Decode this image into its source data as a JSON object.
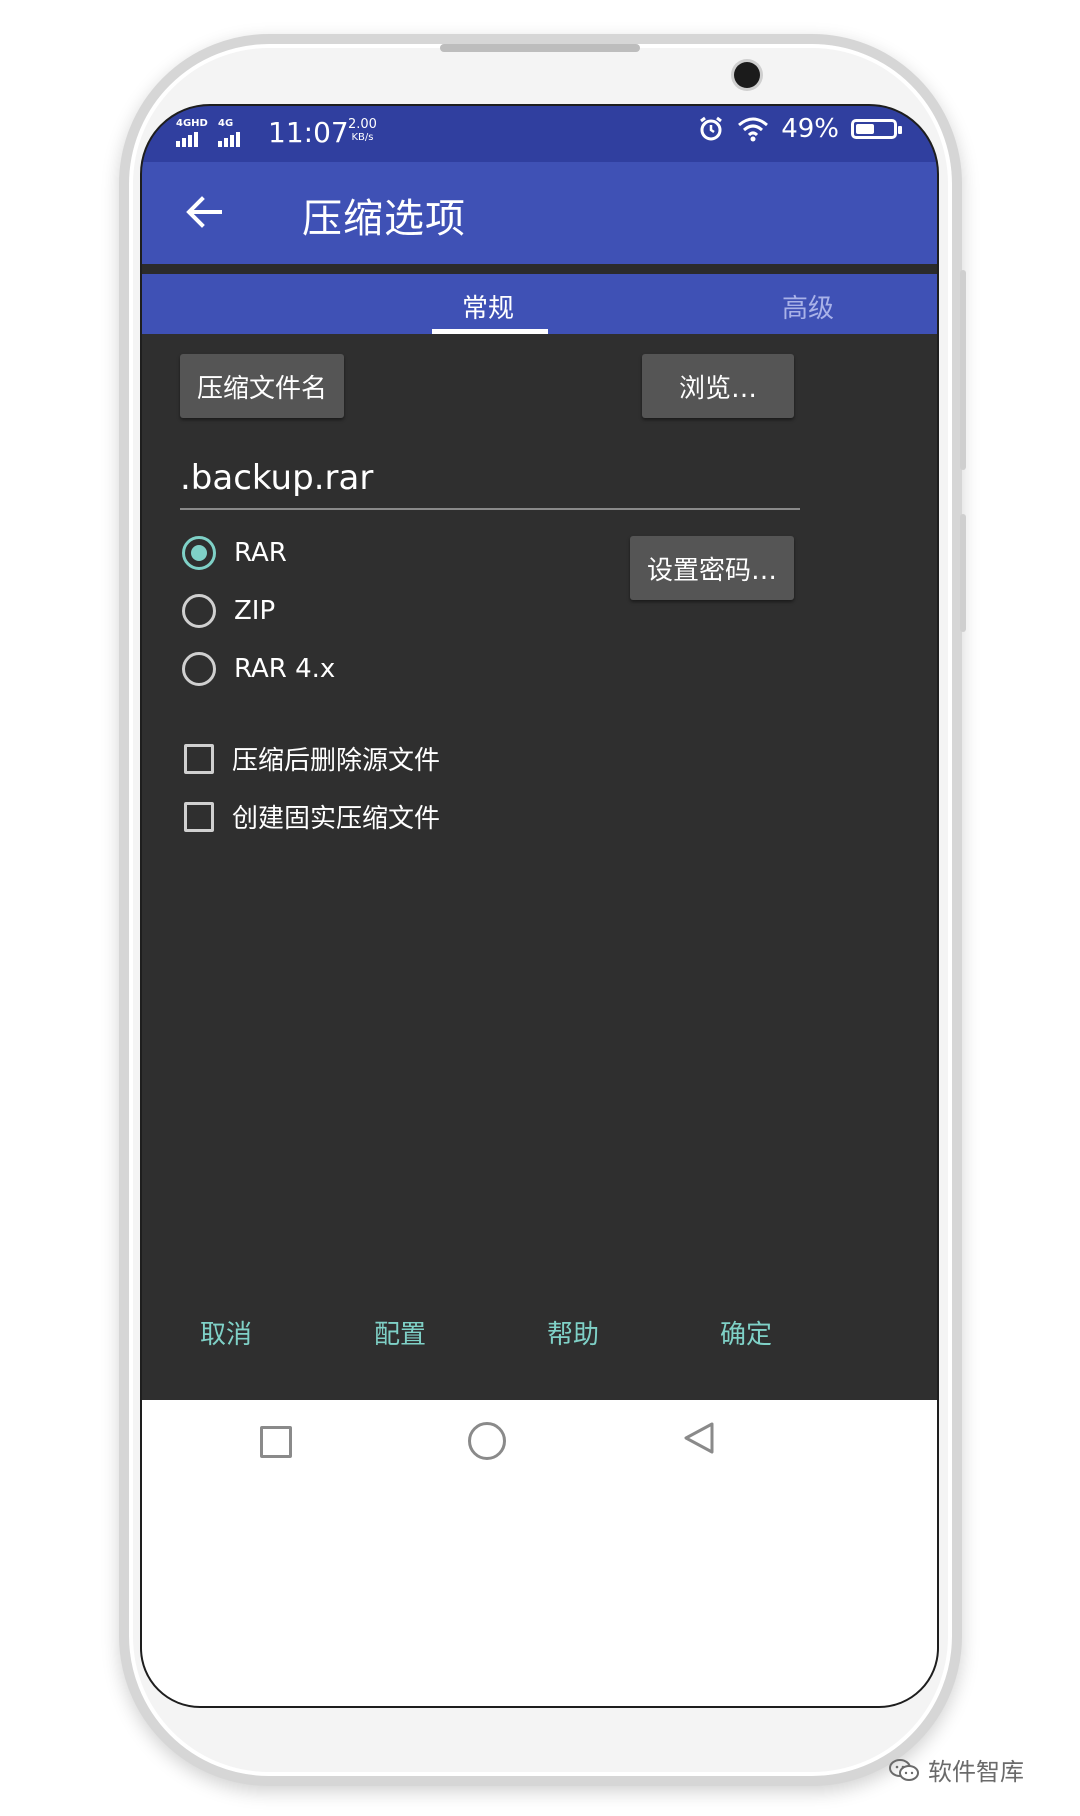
{
  "statusbar": {
    "network1": "4GHD",
    "network2": "4G",
    "time": "11:07",
    "speed_value": "2.00",
    "speed_unit": "KB/s",
    "battery": "49%"
  },
  "appbar": {
    "title": "压缩选项",
    "back_icon": "arrow-left-icon"
  },
  "tabs": [
    {
      "label": "常规"
    },
    {
      "label": "高级"
    }
  ],
  "general": {
    "filename_button": "压缩文件名",
    "browse_button": "浏览…",
    "filename_value": ".backup.rar",
    "password_button": "设置密码…",
    "formats": [
      {
        "label": "RAR",
        "selected": true
      },
      {
        "label": "ZIP",
        "selected": false
      },
      {
        "label": "RAR 4.x",
        "selected": false
      }
    ],
    "options": [
      {
        "label": "压缩后删除源文件",
        "checked": false
      },
      {
        "label": "创建固实压缩文件",
        "checked": false
      }
    ]
  },
  "actions": {
    "cancel": "取消",
    "profiles": "配置",
    "help": "帮助",
    "ok": "确定"
  },
  "colors": {
    "primary": "#3f51b5",
    "primary_dark": "#303f9f",
    "accent": "#7fd1c7",
    "surface": "#2f2f2f",
    "button": "#555555"
  },
  "watermark": "软件智库"
}
